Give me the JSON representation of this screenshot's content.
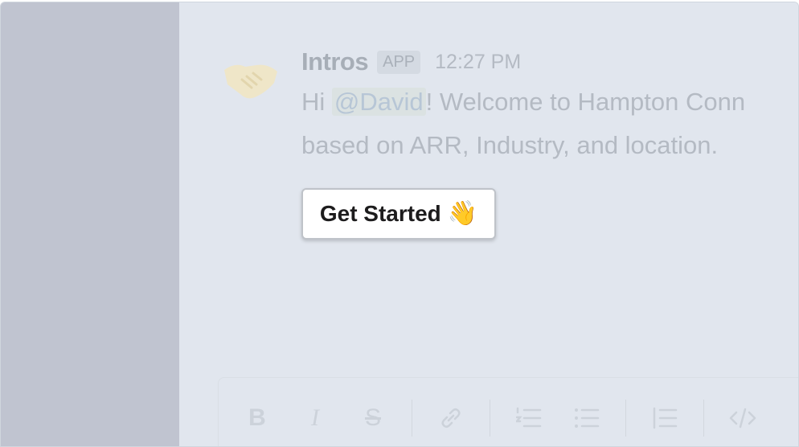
{
  "message": {
    "sender": "Intros",
    "badge": "APP",
    "time": "12:27 PM",
    "greeting": "Hi ",
    "mention": "@David",
    "line1_rest": "! Welcome to Hampton Conn",
    "line2": "based on ARR, Industry, and location."
  },
  "button": {
    "label": "Get Started",
    "emoji": "👋"
  },
  "toolbar": {
    "bold": "B",
    "italic": "I",
    "strike": "S"
  },
  "icons": [
    "handshake-icon",
    "bold-icon",
    "italic-icon",
    "strikethrough-icon",
    "link-icon",
    "ordered-list-icon",
    "bulleted-list-icon",
    "blockquote-icon",
    "code-icon"
  ]
}
